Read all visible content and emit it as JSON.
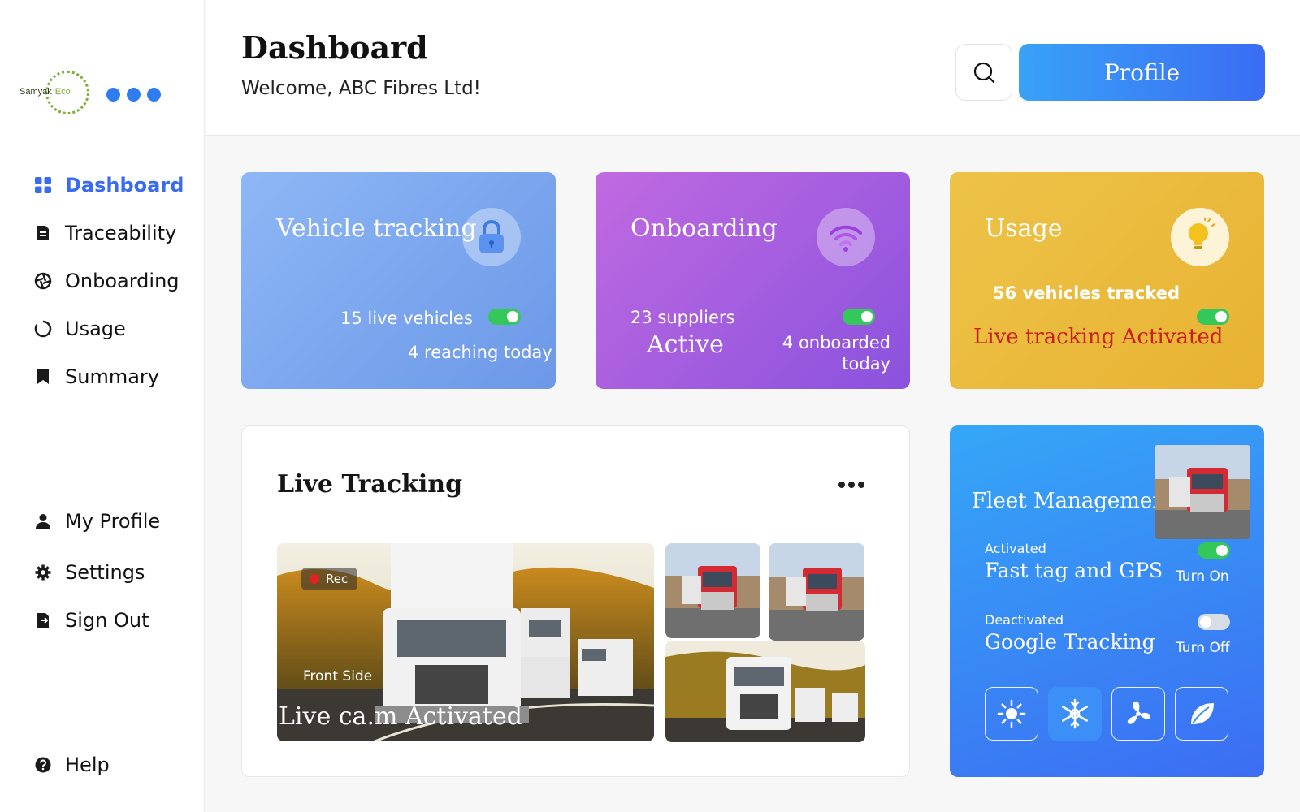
{
  "brand": {
    "name": "Samyak",
    "accent": "Eco",
    "color": "#7fae3a"
  },
  "sidebar": {
    "items": [
      {
        "label": "Dashboard",
        "icon": "grid-icon",
        "active": true
      },
      {
        "label": "Traceability",
        "icon": "document-icon"
      },
      {
        "label": "Onboarding",
        "icon": "aperture-icon"
      },
      {
        "label": "Usage",
        "icon": "ring-icon"
      },
      {
        "label": "Summary",
        "icon": "bookmark-icon"
      }
    ],
    "bottom_items": [
      {
        "label": "My Profile",
        "icon": "user-icon"
      },
      {
        "label": "Settings",
        "icon": "gear-icon"
      },
      {
        "label": "Sign Out",
        "icon": "sign-out-icon"
      }
    ],
    "help": {
      "label": "Help",
      "icon": "help-icon"
    }
  },
  "header": {
    "title": "Dashboard",
    "welcome": "Welcome, ABC Fibres Ltd!",
    "profile_label": "Profile"
  },
  "cards": {
    "vehicle": {
      "title": "Vehicle tracking",
      "live": "15 live vehicles",
      "reaching": "4 reaching today",
      "toggle_on": true
    },
    "onboarding": {
      "title": "Onboarding",
      "suppliers": "23 suppliers",
      "active": "Active",
      "onboarded_line1": "4 onboarded",
      "onboarded_line2": "today",
      "toggle_on": true
    },
    "usage": {
      "title": "Usage",
      "tracked": "56 vehicles tracked",
      "status": "Live tracking Activated",
      "toggle_on": true
    }
  },
  "live_tracking": {
    "title": "Live Tracking",
    "rec_label": "Rec",
    "camera_label": "Front Side",
    "camera_status": "Live ca.m Activated"
  },
  "fleet": {
    "title": "Fleet Management",
    "features": [
      {
        "state": "Activated",
        "name": "Fast tag and GPS",
        "action": "Turn On",
        "on": true
      },
      {
        "state": "Deactivated",
        "name": "Google Tracking",
        "action": "Turn Off",
        "on": false
      }
    ],
    "modes": [
      "sun-icon",
      "snowflake-icon",
      "fan-icon",
      "leaf-icon"
    ],
    "selected_mode": "snowflake-icon"
  },
  "colors": {
    "primary": "#3b6cf0",
    "toggle_on": "#34c759",
    "alert": "#c81e1e"
  }
}
